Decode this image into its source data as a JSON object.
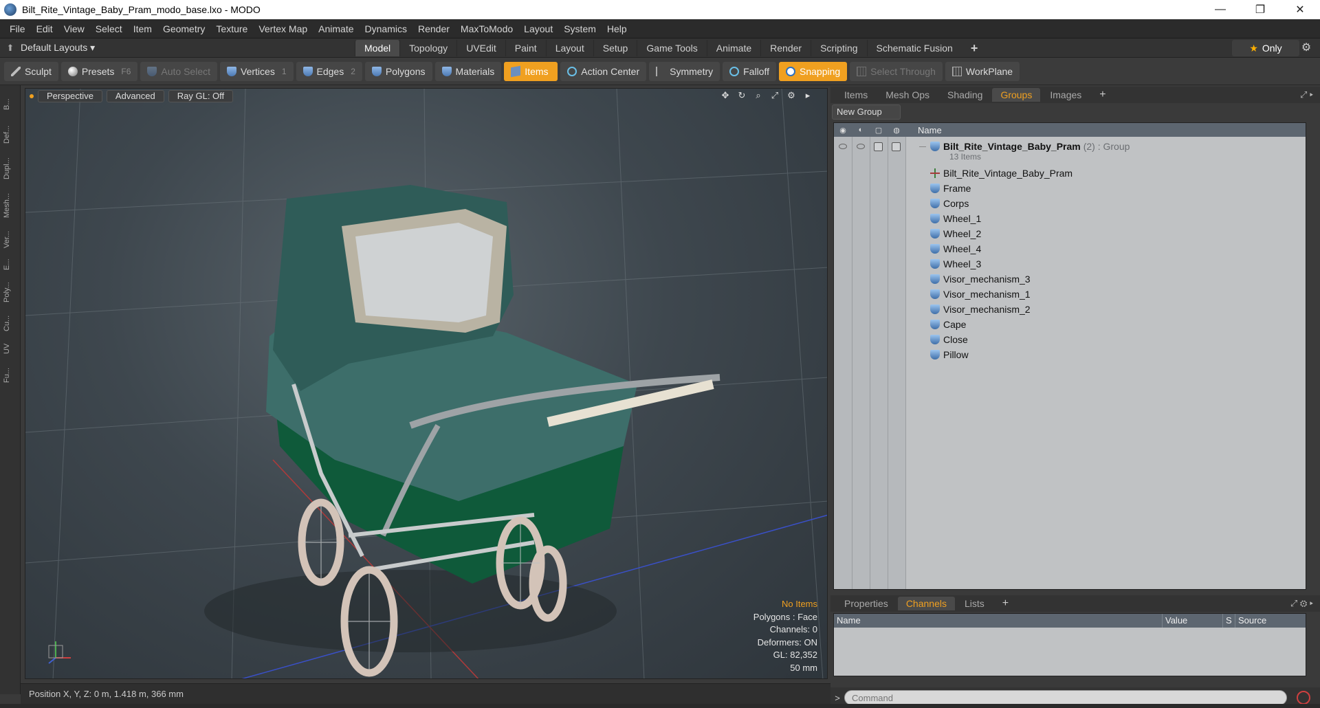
{
  "window": {
    "title": "Bilt_Rite_Vintage_Baby_Pram_modo_base.lxo - MODO",
    "minimize": "—",
    "maximize": "❐",
    "close": "✕"
  },
  "menu": [
    "File",
    "Edit",
    "View",
    "Select",
    "Item",
    "Geometry",
    "Texture",
    "Vertex Map",
    "Animate",
    "Dynamics",
    "Render",
    "MaxToModo",
    "Layout",
    "System",
    "Help"
  ],
  "layoutbar": {
    "layouts": "Default Layouts ▾",
    "tabs": [
      "Model",
      "Topology",
      "UVEdit",
      "Paint",
      "Layout",
      "Setup",
      "Game Tools",
      "Animate",
      "Render",
      "Scripting",
      "Schematic Fusion"
    ],
    "active_tab": "Model",
    "plus": "+",
    "only": "Only"
  },
  "toolbar": {
    "sculpt": "Sculpt",
    "presets": "Presets",
    "presets_key": "F6",
    "auto_select": "Auto Select",
    "vertices": "Vertices",
    "vertices_count": "1",
    "edges": "Edges",
    "edges_count": "2",
    "polygons": "Polygons",
    "materials": "Materials",
    "items": "Items",
    "action_center": "Action Center",
    "symmetry": "Symmetry",
    "falloff": "Falloff",
    "snapping": "Snapping",
    "select_through": "Select Through",
    "workplane": "WorkPlane"
  },
  "leftstrip": [
    "B...",
    "Def...",
    "Dupl...",
    "Mesh...",
    "Ver...",
    "E...",
    "Poly...",
    "Cu...",
    "UV",
    "Fu..."
  ],
  "viewport": {
    "perspective": "Perspective",
    "advanced": "Advanced",
    "raygl": "Ray GL: Off",
    "stats": {
      "no_items": "No Items",
      "polygons": "Polygons : Face",
      "channels": "Channels: 0",
      "deformers": "Deformers: ON",
      "gl": "GL: 82,352",
      "scale": "50 mm"
    }
  },
  "status": {
    "position": "Position X, Y, Z:   0 m, 1.418 m, 366 mm"
  },
  "right_panel": {
    "tabs": [
      "Items",
      "Mesh Ops",
      "Shading",
      "Groups",
      "Images"
    ],
    "active_tab": "Groups",
    "plus": "+",
    "new_group": "New Group",
    "name_header": "Name",
    "root": {
      "name": "Bilt_Rite_Vintage_Baby_Pram",
      "meta": "(2) : Group",
      "sub": "13 Items"
    },
    "items": [
      {
        "name": "Bilt_Rite_Vintage_Baby_Pram",
        "icon": "locator-icon"
      },
      {
        "name": "Frame",
        "icon": "mesh-icon"
      },
      {
        "name": "Corps",
        "icon": "mesh-icon"
      },
      {
        "name": "Wheel_1",
        "icon": "mesh-icon"
      },
      {
        "name": "Wheel_2",
        "icon": "mesh-icon"
      },
      {
        "name": "Wheel_4",
        "icon": "mesh-icon"
      },
      {
        "name": "Wheel_3",
        "icon": "mesh-icon"
      },
      {
        "name": "Visor_mechanism_3",
        "icon": "mesh-icon"
      },
      {
        "name": "Visor_mechanism_1",
        "icon": "mesh-icon"
      },
      {
        "name": "Visor_mechanism_2",
        "icon": "mesh-icon"
      },
      {
        "name": "Cape",
        "icon": "mesh-icon"
      },
      {
        "name": "Close",
        "icon": "mesh-icon"
      },
      {
        "name": "Pillow",
        "icon": "mesh-icon"
      }
    ],
    "bottom_tabs": [
      "Properties",
      "Channels",
      "Lists"
    ],
    "bottom_active": "Channels",
    "channels_headers": [
      "Name",
      "Value",
      "S",
      "Source"
    ],
    "command_placeholder": "Command"
  },
  "colors": {
    "accent": "#f0a020",
    "pram_body": "#3d6e6a",
    "pram_lower": "#0f5a3a"
  }
}
